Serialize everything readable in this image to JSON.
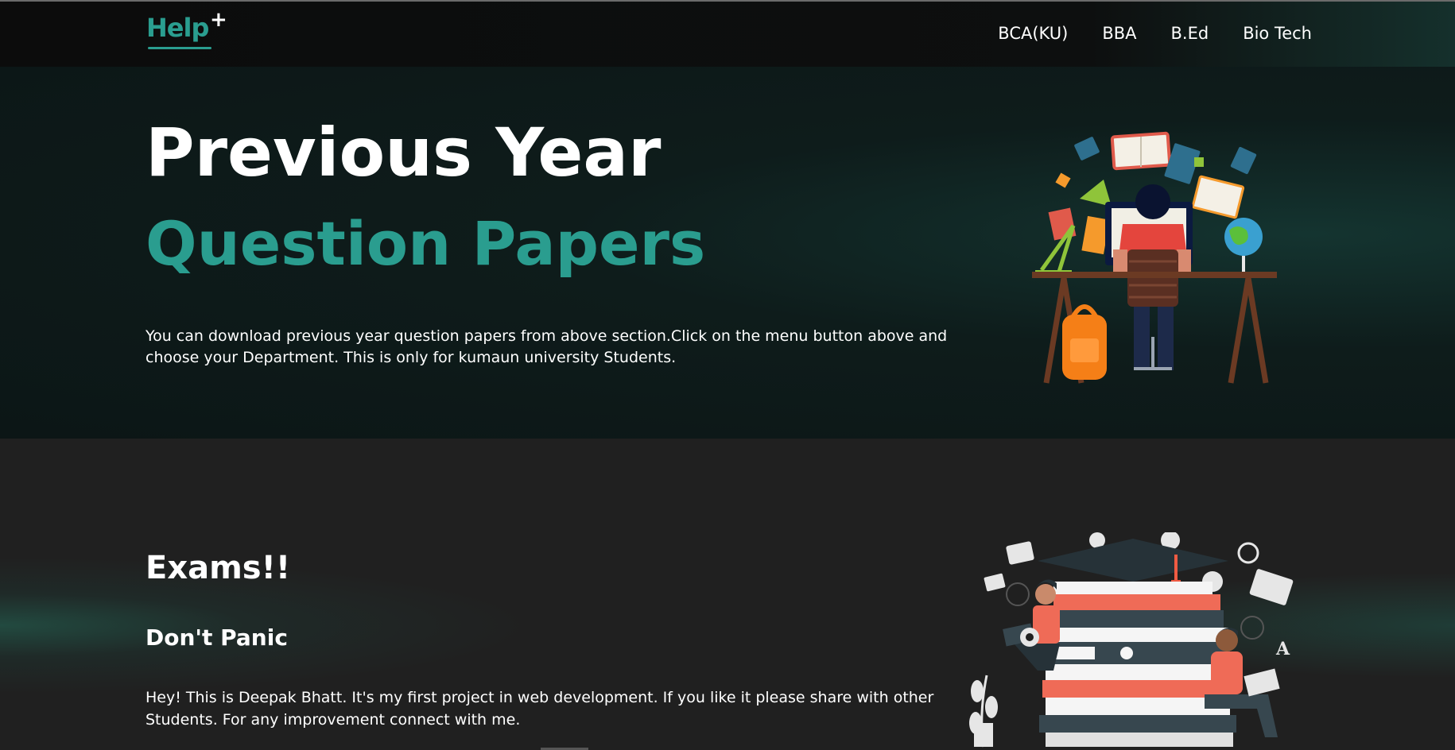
{
  "header": {
    "logo_text": "Help",
    "logo_plus": "+",
    "nav": [
      "BCA(KU)",
      "BBA",
      "B.Ed",
      "Bio Tech"
    ]
  },
  "hero": {
    "title": "Previous Year",
    "subtitle": "Question Papers",
    "description": "You can download previous year question papers from above section.Click on the menu button above and choose your Department. This is only for kumaun university Students."
  },
  "about": {
    "title": "Exams!!",
    "subtitle": "Don't Panic",
    "description": "Hey! This is Deepak Bhatt. It's my first project in web development. If you like it please share with other Students. For any improvement connect with me."
  },
  "colors": {
    "accent": "#2a9d8f",
    "header_bg": "#0c0c0c",
    "hero_bg": "#0c1616",
    "section_bg": "#202020"
  }
}
